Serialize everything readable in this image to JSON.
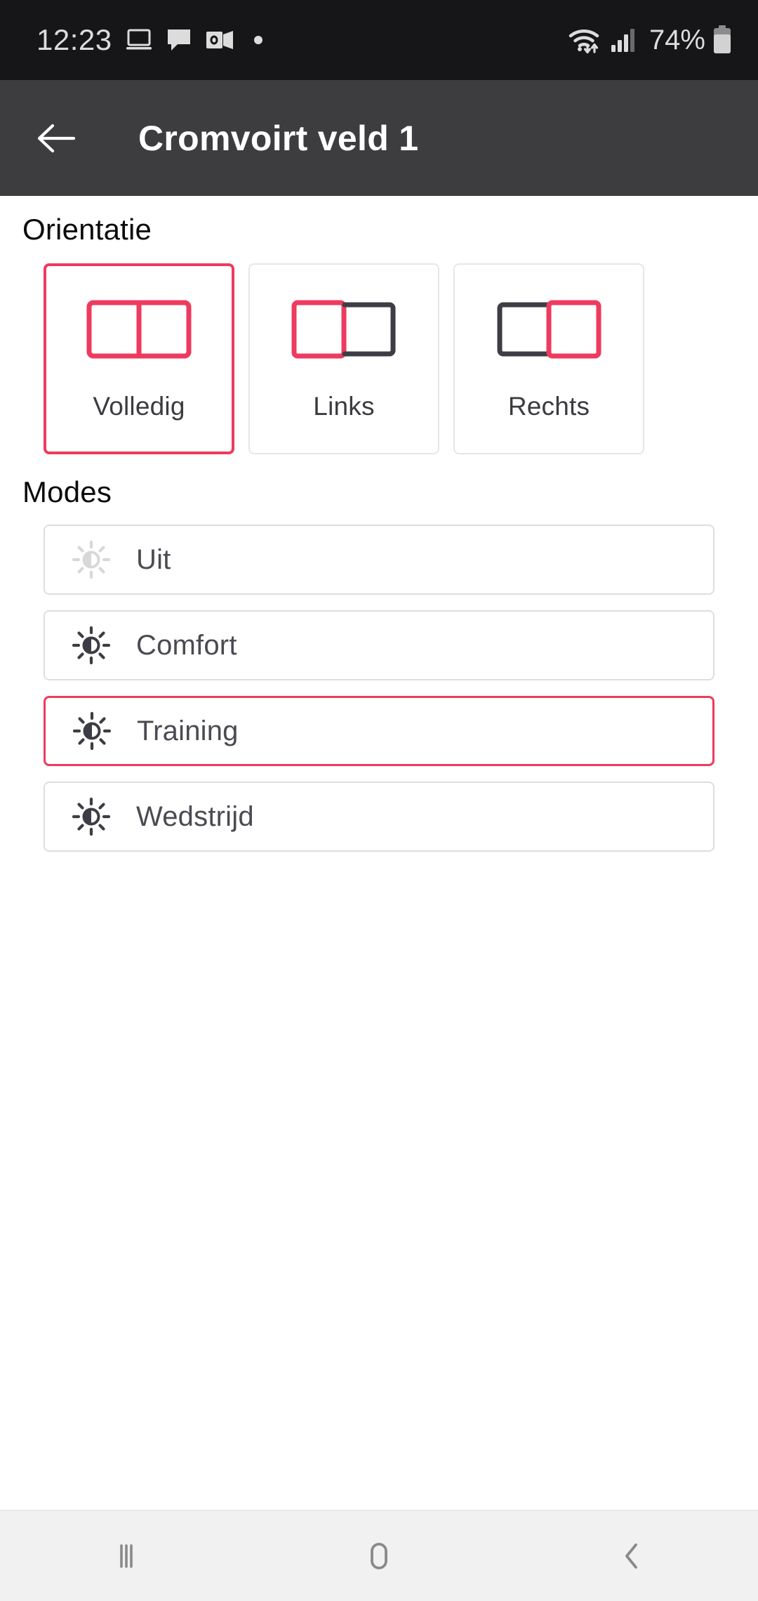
{
  "status_bar": {
    "time": "12:23",
    "battery_percent": "74%",
    "icons": [
      "laptop-icon",
      "chat-bubble-icon",
      "outlook-icon",
      "dot-icon",
      "wifi-icon",
      "signal-icon",
      "battery-icon"
    ],
    "background_color": "#161618",
    "text_color": "#dcdcdc"
  },
  "app_bar": {
    "title": "Cromvoirt veld 1",
    "back_icon": "arrow-left-icon",
    "background_color": "#3d3d40"
  },
  "orientation": {
    "heading": "Orientatie",
    "selected": "Volledig",
    "options": [
      {
        "label": "Volledig",
        "icon": "split-both-icon",
        "left_active": true,
        "right_active": true,
        "selected": true
      },
      {
        "label": "Links",
        "icon": "split-left-icon",
        "left_active": true,
        "right_active": false,
        "selected": false
      },
      {
        "label": "Rechts",
        "icon": "split-right-icon",
        "left_active": false,
        "right_active": true,
        "selected": false
      }
    ]
  },
  "modes": {
    "heading": "Modes",
    "selected": "Training",
    "options": [
      {
        "label": "Uit",
        "icon": "brightness-icon",
        "enabled": false,
        "selected": false
      },
      {
        "label": "Comfort",
        "icon": "brightness-icon",
        "enabled": true,
        "selected": false
      },
      {
        "label": "Training",
        "icon": "brightness-icon",
        "enabled": true,
        "selected": true
      },
      {
        "label": "Wedstrijd",
        "icon": "brightness-icon",
        "enabled": true,
        "selected": false
      }
    ]
  },
  "nav_bar": {
    "buttons": [
      {
        "name": "recents-icon"
      },
      {
        "name": "home-icon"
      },
      {
        "name": "back-icon"
      }
    ],
    "background_color": "#f1f1f1"
  },
  "colors": {
    "accent": "#ee3a5e",
    "dark_icon": "#3d3d45",
    "muted_icon": "#d6d6d6",
    "border": "#dedede"
  }
}
